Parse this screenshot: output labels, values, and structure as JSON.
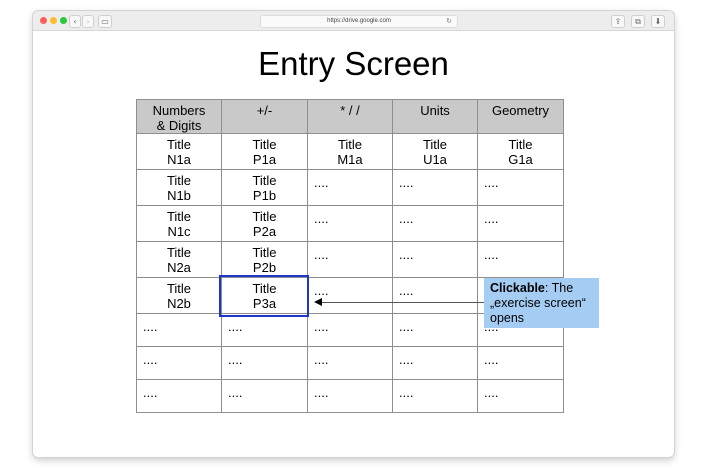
{
  "browser": {
    "url": "https://drive.google.com"
  },
  "page": {
    "title": "Entry Screen"
  },
  "table": {
    "headers": [
      [
        "Numbers",
        "& Digits"
      ],
      [
        "+/-"
      ],
      [
        "* / /"
      ],
      [
        "Units"
      ],
      [
        "Geometry"
      ]
    ],
    "rows": [
      [
        [
          "Title",
          "N1a"
        ],
        [
          "Title",
          "P1a"
        ],
        [
          "Title",
          "M1a"
        ],
        [
          "Title",
          "U1a"
        ],
        [
          "Title",
          "G1a"
        ]
      ],
      [
        [
          "Title",
          "N1b"
        ],
        [
          "Title",
          "P1b"
        ],
        [
          "...."
        ],
        [
          "...."
        ],
        [
          "...."
        ]
      ],
      [
        [
          "Title",
          "N1c"
        ],
        [
          "Title",
          "P2a"
        ],
        [
          "...."
        ],
        [
          "...."
        ],
        [
          "...."
        ]
      ],
      [
        [
          "Title",
          "N2a"
        ],
        [
          "Title",
          "P2b"
        ],
        [
          "...."
        ],
        [
          "...."
        ],
        [
          "...."
        ]
      ],
      [
        [
          "Title",
          "N2b"
        ],
        [
          "Title",
          "P3a"
        ],
        [
          "...."
        ],
        [
          "...."
        ],
        [
          ""
        ]
      ],
      [
        [
          "...."
        ],
        [
          "...."
        ],
        [
          "...."
        ],
        [
          "...."
        ],
        [
          "...."
        ]
      ],
      [
        [
          "...."
        ],
        [
          "...."
        ],
        [
          "...."
        ],
        [
          "...."
        ],
        [
          "...."
        ]
      ],
      [
        [
          "...."
        ],
        [
          "...."
        ],
        [
          "...."
        ],
        [
          "...."
        ],
        [
          "...."
        ]
      ]
    ]
  },
  "callout": {
    "bold": "Clickable",
    "rest": ": The „exercise screen“ opens"
  }
}
